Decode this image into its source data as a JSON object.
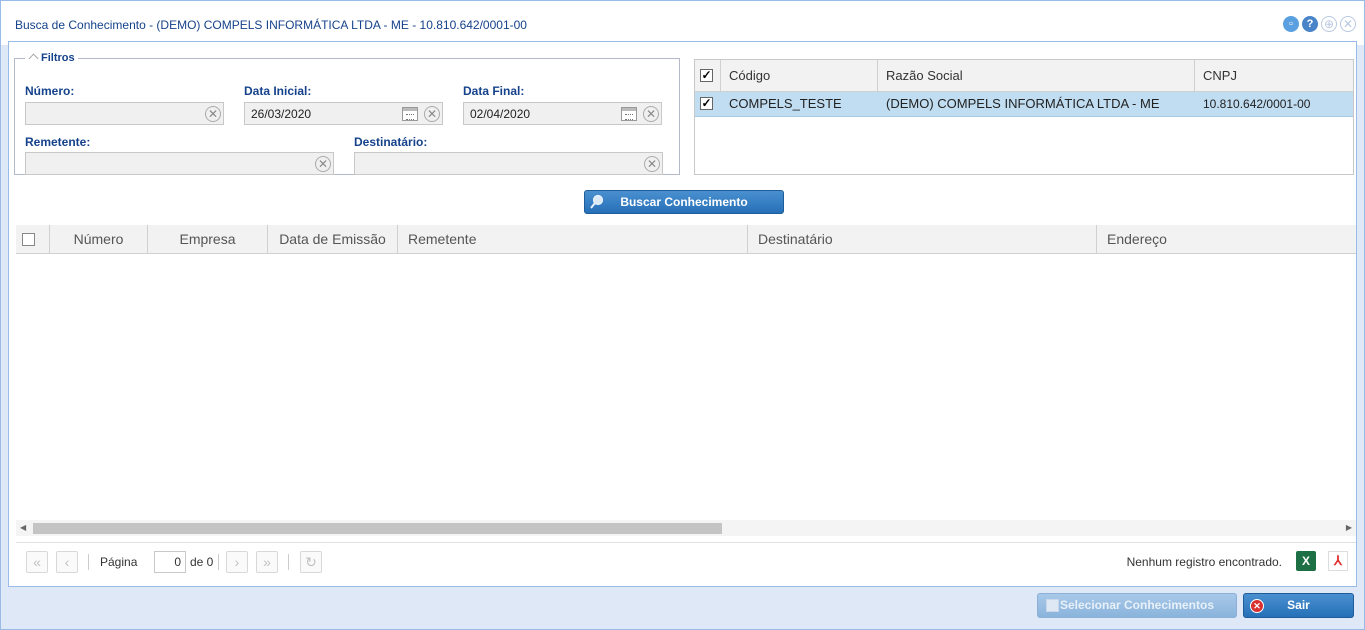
{
  "window": {
    "title": "Busca de Conhecimento - (DEMO) COMPELS INFORMÁTICA LTDA - ME - 10.810.642/0001-00"
  },
  "filters": {
    "legend": "Filtros",
    "numero_label": "Número:",
    "numero_value": "",
    "data_inicial_label": "Data Inicial:",
    "data_inicial_value": "26/03/2020",
    "data_final_label": "Data Final:",
    "data_final_value": "02/04/2020",
    "remetente_label": "Remetente:",
    "remetente_value": "",
    "destinatario_label": "Destinatário:",
    "destinatario_value": ""
  },
  "company_grid": {
    "columns": [
      "Código",
      "Razão Social",
      "CNPJ"
    ],
    "header_checked": true,
    "rows": [
      {
        "checked": true,
        "codigo": "COMPELS_TESTE",
        "razao_social": "(DEMO) COMPELS INFORMÁTICA LTDA - ME",
        "cnpj": "10.810.642/0001-00"
      }
    ]
  },
  "search_button": {
    "label": "Buscar Conhecimento"
  },
  "results_grid": {
    "columns": [
      "Número",
      "Empresa",
      "Data de Emissão",
      "Remetente",
      "Destinatário",
      "Endereço"
    ],
    "rows": []
  },
  "pager": {
    "page_label": "Página",
    "page_value": "0",
    "of_label": "de 0",
    "status": "Nenhum registro encontrado.",
    "excel_glyph": "X",
    "pdf_glyph": "⅄"
  },
  "footer": {
    "select_label": "Selecionar Conhecimentos",
    "exit_label": "Sair"
  },
  "colors": {
    "accent": "#2670b8",
    "title_text": "#15428b",
    "selected_row": "#c1ddf1"
  }
}
